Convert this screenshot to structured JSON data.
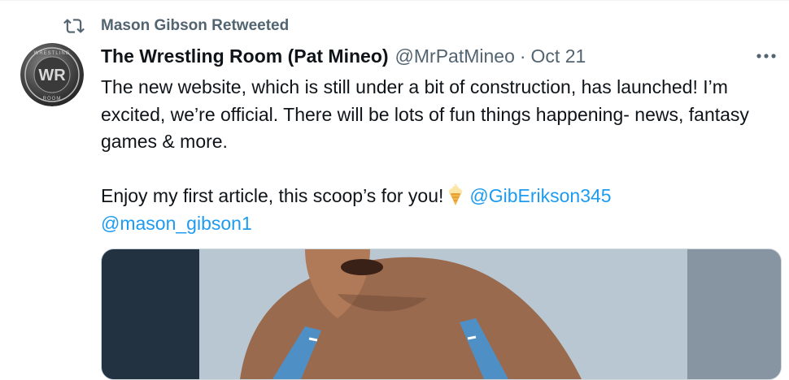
{
  "retweet": {
    "icon": "retweet-icon",
    "text": "Mason Gibson Retweeted"
  },
  "tweet": {
    "avatar_icon": "wrestling-room-logo",
    "name": "The Wrestling Room (Pat Mineo)",
    "handle": "@MrPatMineo",
    "separator": "·",
    "date": "Oct 21",
    "more_icon": "more-options-icon",
    "paragraph1": "The new website, which is still under a bit of construction, has launched! I’m excited, we’re official. There will be lots of fun things happening- news, fantasy games & more.",
    "paragraph2_text": "Enjoy my first article, this scoop’s for you!",
    "emoji": "ice-cream-icon",
    "mention1": "@GibErikson345",
    "mention2": "@mason_gibson1",
    "media": "wrestler-photo"
  }
}
